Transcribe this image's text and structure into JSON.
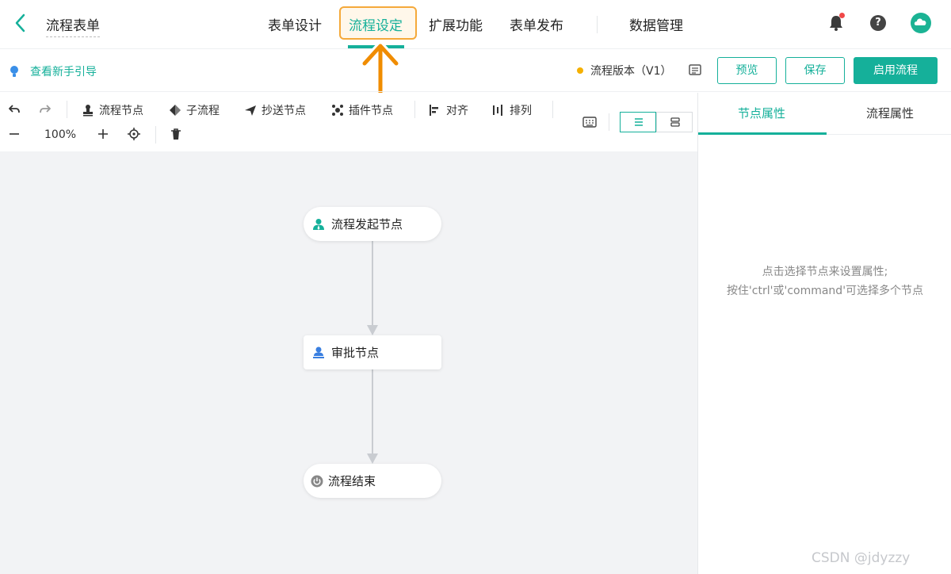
{
  "header": {
    "title": "流程表单",
    "tabs": [
      "表单设计",
      "流程设定",
      "扩展功能",
      "表单发布",
      "数据管理"
    ],
    "active_tab": "流程设定"
  },
  "subbar": {
    "guide_link": "查看新手引导",
    "version_label": "流程版本（V1）",
    "buttons": {
      "preview": "预览",
      "save": "保存",
      "enable": "启用流程"
    }
  },
  "toolbar": {
    "items": [
      "流程节点",
      "子流程",
      "抄送节点",
      "插件节点",
      "对齐",
      "排列"
    ],
    "zoom": "100%"
  },
  "flow": {
    "nodes": [
      {
        "label": "流程发起节点",
        "icon": "initiator-user-icon"
      },
      {
        "label": "审批节点",
        "icon": "approver-user-icon"
      },
      {
        "label": "流程结束",
        "icon": "power-end-icon"
      }
    ]
  },
  "panel": {
    "tabs": [
      "节点属性",
      "流程属性"
    ],
    "active_tab": "节点属性",
    "hint_line1": "点击选择节点来设置属性;",
    "hint_line2": "按住'ctrl'或'command'可选择多个节点"
  },
  "watermark": "CSDN @jdyzzy",
  "colors": {
    "accent": "#15b09a",
    "highlight": "#f5a93a",
    "arrow": "#f08c00",
    "version_dot": "#f5b000",
    "notification_dot": "#f04848"
  }
}
